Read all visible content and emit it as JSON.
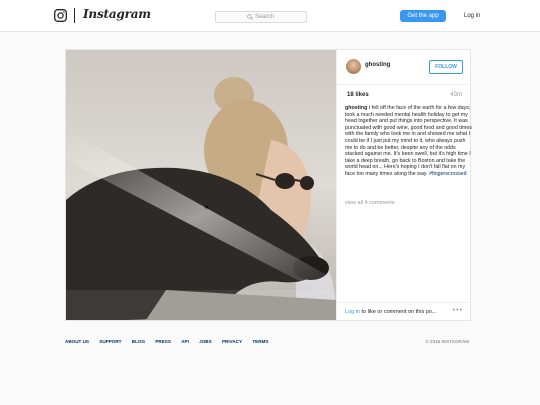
{
  "header": {
    "wordmark": "Instagram",
    "search_placeholder": "Search",
    "get_app_label": "Get the app",
    "login_label": "Log in"
  },
  "post": {
    "username": "ghosting",
    "follow_label": "FOLLOW",
    "likes": "18 likes",
    "time": "43m",
    "caption_user": "ghosting",
    "caption": "I fell off the face of the earth for a few days; took a much needed mental health holiday to get my head together and put things into perspective. It was punctuated with good wine, good food and good times with the family who took me in and showed me what I could be if I just put my mind to it, who always push me to do and be better, despite any of the odds stacked against me. It's been swell, but it's high time I take a deep breath, go back to Boston and take the world head on... Here's hoping I don't fall flat on my face too many times along the way.",
    "hashtag": "#fingerscrossed",
    "view_all": "view all 4 comments",
    "login_link": "Log in",
    "comment_prompt": " to like or comment on this po...",
    "more": "•••"
  },
  "footer": {
    "links": [
      "ABOUT US",
      "SUPPORT",
      "BLOG",
      "PRESS",
      "API",
      "JOBS",
      "PRIVACY",
      "TERMS"
    ],
    "copyright": "© 2016 INSTAGRAM"
  },
  "colors": {
    "accent": "#3897f0",
    "link_dark": "#003569",
    "muted": "#999999"
  },
  "icons": {
    "logo": "instagram-camera-icon",
    "search": "search-icon",
    "more": "more-options-icon"
  }
}
